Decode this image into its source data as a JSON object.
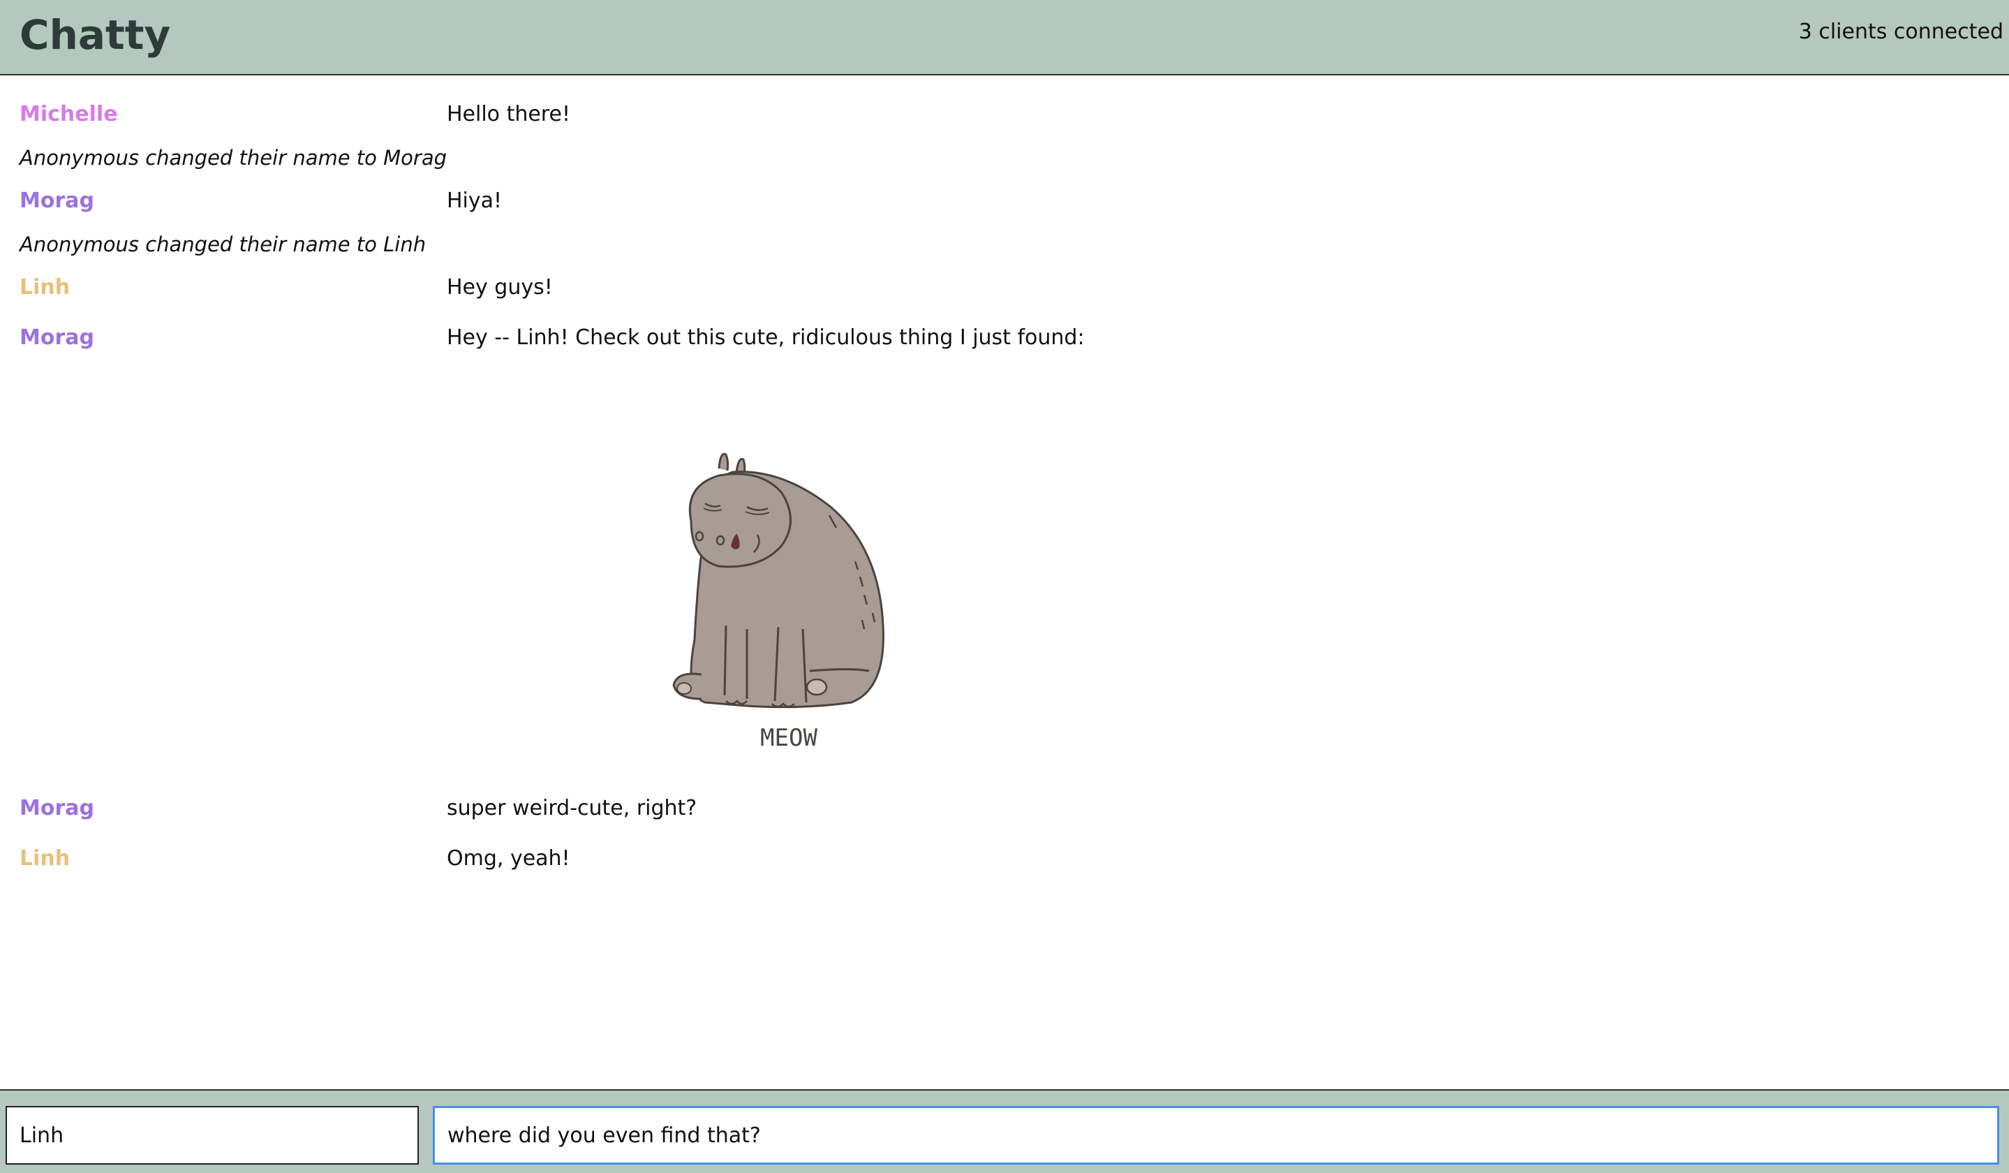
{
  "app": {
    "title": "Chatty",
    "clients_connected": "3 clients connected"
  },
  "colors": {
    "header_bg": "#b5c8c0",
    "michelle": "#d97be8",
    "morag": "#9b72e0",
    "linh": "#e8c07a",
    "input_focus": "#4a90d9"
  },
  "messages": [
    {
      "type": "message",
      "user": "Michelle",
      "text": "Hello there!"
    },
    {
      "type": "system",
      "text": "Anonymous changed their name to Morag"
    },
    {
      "type": "message",
      "user": "Morag",
      "text": "Hiya!"
    },
    {
      "type": "system",
      "text": "Anonymous changed their name to Linh"
    },
    {
      "type": "message",
      "user": "Linh",
      "text": "Hey guys!"
    },
    {
      "type": "message",
      "user": "Morag",
      "text": "Hey -- Linh! Check out this cute, ridiculous thing I just found:"
    },
    {
      "type": "image",
      "caption": "MEOW",
      "icon": "hippo-cat-illustration"
    },
    {
      "type": "message",
      "user": "Morag",
      "text": "super weird-cute, right?"
    },
    {
      "type": "message",
      "user": "Linh",
      "text": "Omg, yeah!"
    }
  ],
  "composer": {
    "name_value": "Linh",
    "message_value": "where did you even find that?"
  }
}
